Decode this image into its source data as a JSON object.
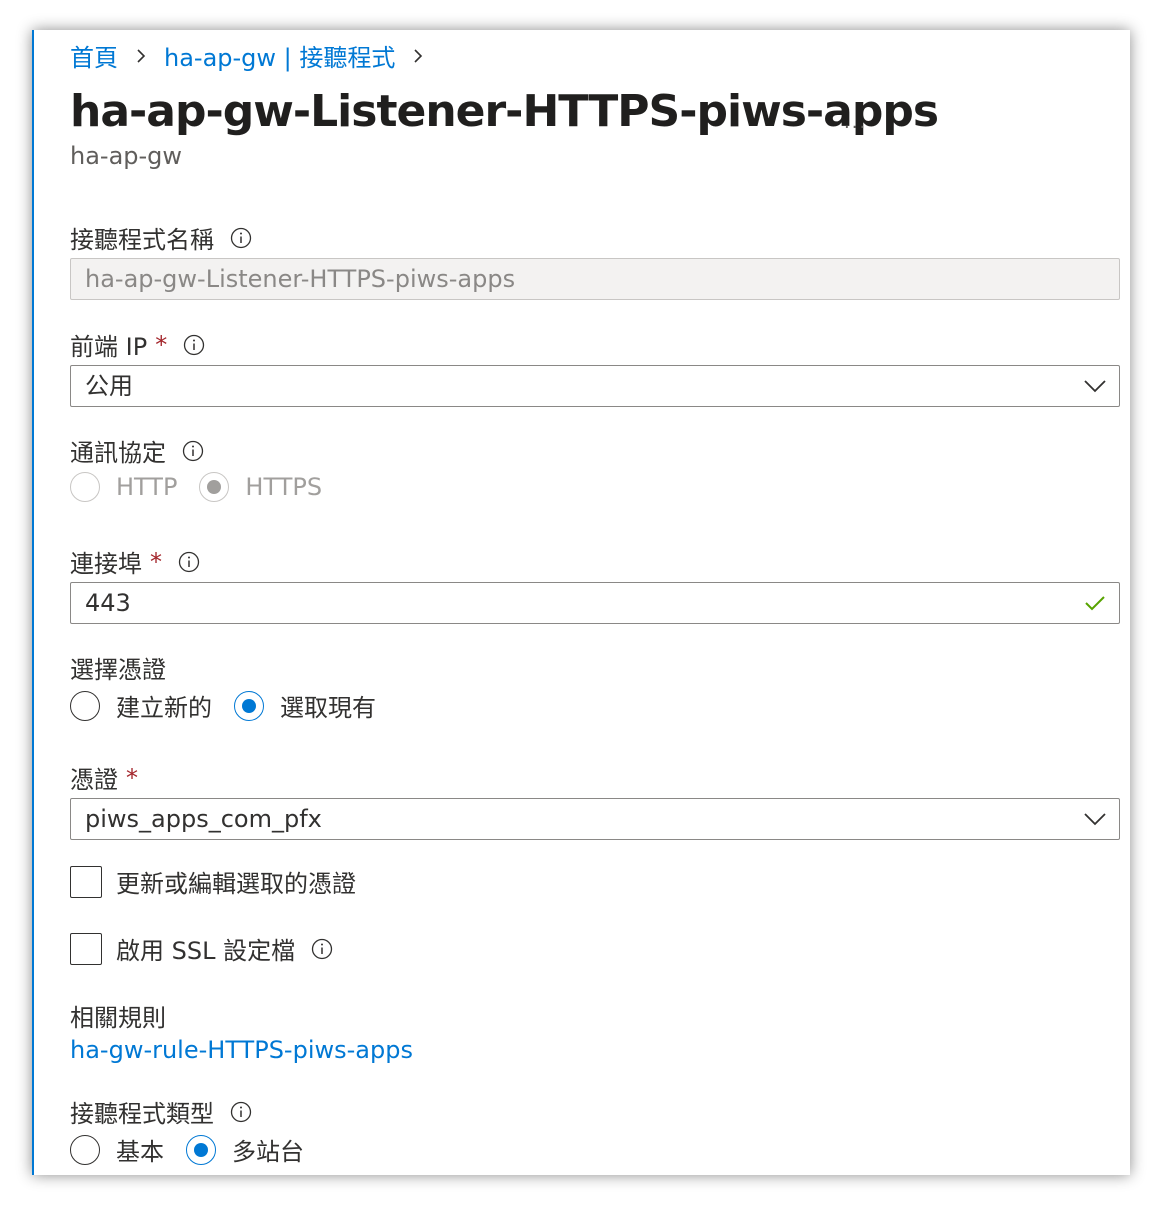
{
  "breadcrumb": {
    "home": "首頁",
    "parent": "ha-ap-gw | 接聽程式"
  },
  "header": {
    "title": "ha-ap-gw-Listener-HTTPS-piws-apps",
    "subtitle": "ha-ap-gw",
    "more": "..."
  },
  "listener_name": {
    "label": "接聽程式名稱",
    "value": "ha-ap-gw-Listener-HTTPS-piws-apps"
  },
  "frontend_ip": {
    "label": "前端 IP",
    "required": "*",
    "value": "公用"
  },
  "protocol": {
    "label": "通訊協定",
    "options": [
      "HTTP",
      "HTTPS"
    ],
    "selected": "HTTPS"
  },
  "port": {
    "label": "連接埠",
    "required": "*",
    "value": "443"
  },
  "choose_cert": {
    "label": "選擇憑證",
    "options": [
      "建立新的",
      "選取現有"
    ],
    "selected": "選取現有"
  },
  "certificate": {
    "label": "憑證",
    "required": "*",
    "value": "piws_apps_com_pfx"
  },
  "renew_cert": {
    "label": "更新或編輯選取的憑證",
    "checked": false
  },
  "ssl_profile": {
    "label": "啟用 SSL 設定檔",
    "checked": false
  },
  "related_rules": {
    "label": "相關規則",
    "link": "ha-gw-rule-HTTPS-piws-apps"
  },
  "listener_type": {
    "label": "接聽程式類型",
    "options": [
      "基本",
      "多站台"
    ],
    "selected": "多站台"
  },
  "colors": {
    "accent": "#0078d4",
    "required": "#a4262c",
    "valid": "#57a300"
  }
}
